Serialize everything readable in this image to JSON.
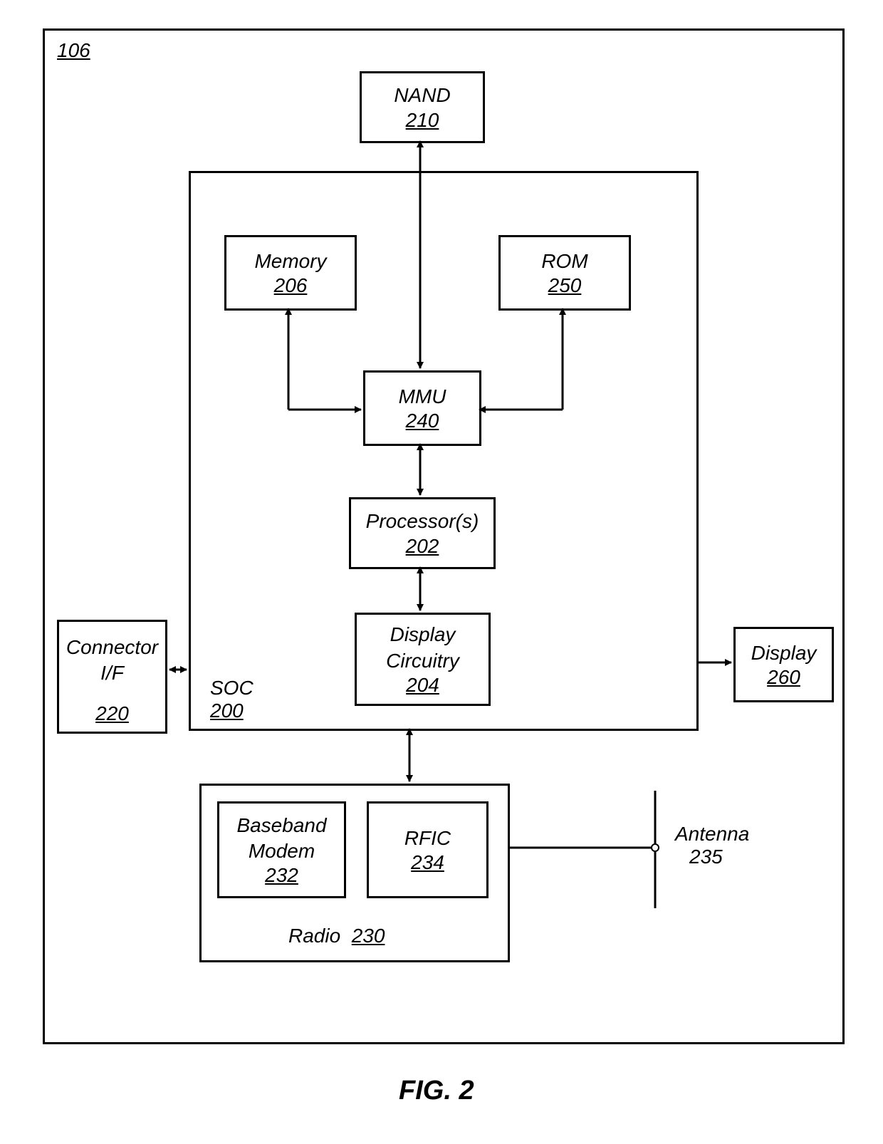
{
  "figure": "FIG. 2",
  "outer": {
    "num": "106"
  },
  "nand": {
    "label": "NAND",
    "num": "210"
  },
  "soc": {
    "label": "SOC",
    "num": "200"
  },
  "memory": {
    "label": "Memory",
    "num": "206"
  },
  "rom": {
    "label": "ROM",
    "num": "250"
  },
  "mmu": {
    "label": "MMU",
    "num": "240"
  },
  "processor": {
    "label": "Processor(s)",
    "num": "202"
  },
  "display_circuitry": {
    "label1": "Display",
    "label2": "Circuitry",
    "num": "204"
  },
  "connector": {
    "label1": "Connector",
    "label2": "I/F",
    "num": "220"
  },
  "display": {
    "label": "Display",
    "num": "260"
  },
  "radio": {
    "label": "Radio",
    "num": "230"
  },
  "baseband": {
    "label1": "Baseband",
    "label2": "Modem",
    "num": "232"
  },
  "rfic": {
    "label": "RFIC",
    "num": "234"
  },
  "antenna": {
    "label": "Antenna",
    "num": "235"
  }
}
